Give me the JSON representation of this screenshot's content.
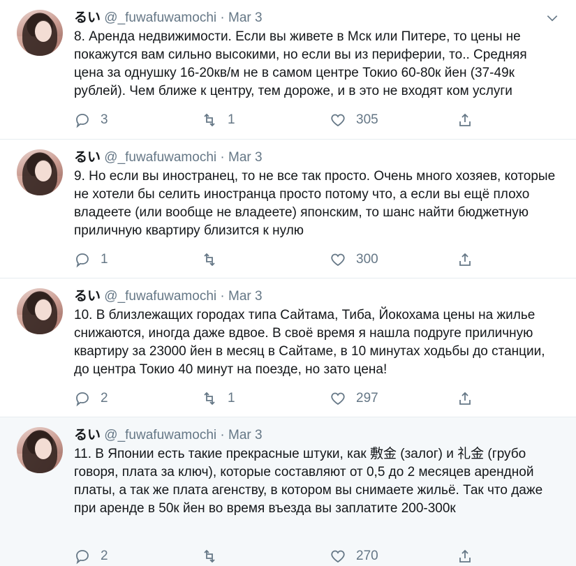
{
  "tweets": [
    {
      "name": "るい",
      "handle": "@_fuwafuwamochi",
      "sep": "·",
      "date": "Mar 3",
      "text": "8. Аренда недвижимости. Если вы живете в Мск или Питере, то цены не покажутся вам сильно высокими, но если вы из периферии, то.. Средняя цена за однушку 16-20кв/м не в самом центре Токио 60-80к йен (37-49к рублей). Чем ближе к центру, тем дороже, и в это не входят ком услуги",
      "replies": "3",
      "retweets": "1",
      "likes": "305"
    },
    {
      "name": "るい",
      "handle": "@_fuwafuwamochi",
      "sep": "·",
      "date": "Mar 3",
      "text": "9. Но если вы иностранец, то не все так просто. Очень много хозяев, которые не хотели бы селить иностранца просто потому что, а если вы ещё плохо владеете (или вообще не владеете) японским, то шанс найти бюджетную приличную квартиру близится к нулю",
      "replies": "1",
      "retweets": "",
      "likes": "300"
    },
    {
      "name": "るい",
      "handle": "@_fuwafuwamochi",
      "sep": "·",
      "date": "Mar 3",
      "text": "10. В близлежащих городах типа Сайтама, Тиба, Йокохама цены на жилье снижаются, иногда даже вдвое. В своё время я нашла подруге приличную квартиру за 23000 йен в месяц в Сайтаме, в 10 минутах ходьбы до станции, до центра Токио 40 минут на поезде, но зато цена!",
      "replies": "2",
      "retweets": "1",
      "likes": "297"
    },
    {
      "name": "るい",
      "handle": "@_fuwafuwamochi",
      "sep": "·",
      "date": "Mar 3",
      "text": "11. В Японии есть такие прекрасные штуки, как 敷金 (залог) и 礼金 (грубо говоря, плата за ключ), которые составляют от 0,5 до 2 месяцев арендной платы, а так же плата агенству, в котором вы снимаете жильё. Так что даже при аренде в 50к йен во время въезда вы заплатите 200-300к",
      "replies": "2",
      "retweets": "",
      "likes": "270"
    }
  ],
  "icons": {
    "reply": "reply-icon",
    "retweet": "retweet-icon",
    "like": "heart-icon",
    "share": "share-icon",
    "caret": "chevron-down-icon"
  },
  "colors": {
    "text": "#14171a",
    "muted": "#657786",
    "divider": "#e6ecf0",
    "highlight_bg": "#f5f8fa"
  }
}
